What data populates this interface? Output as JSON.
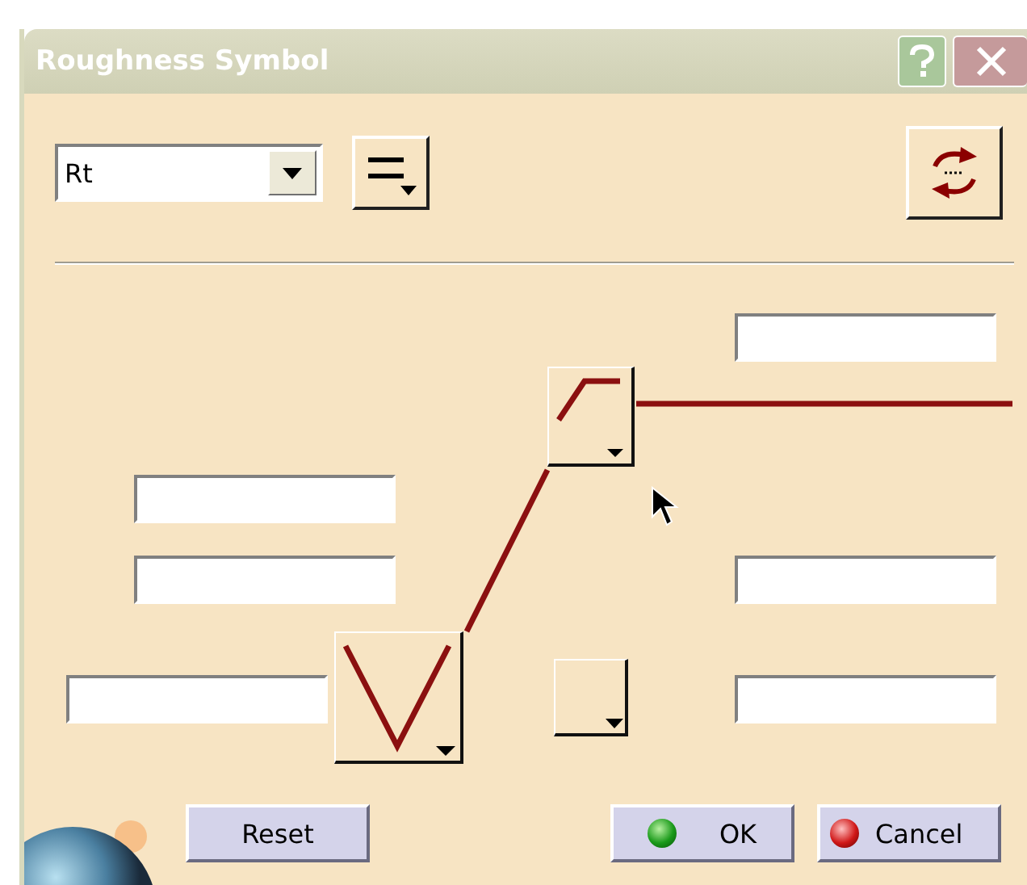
{
  "window": {
    "title": "Roughness Symbol"
  },
  "toolbar": {
    "combo": {
      "value": "Rt"
    }
  },
  "buttons": [
    {
      "label": "Reset",
      "kind": "plain"
    },
    {
      "label": "OK",
      "kind": "ok"
    },
    {
      "label": "Cancel",
      "kind": "cancel"
    }
  ]
}
